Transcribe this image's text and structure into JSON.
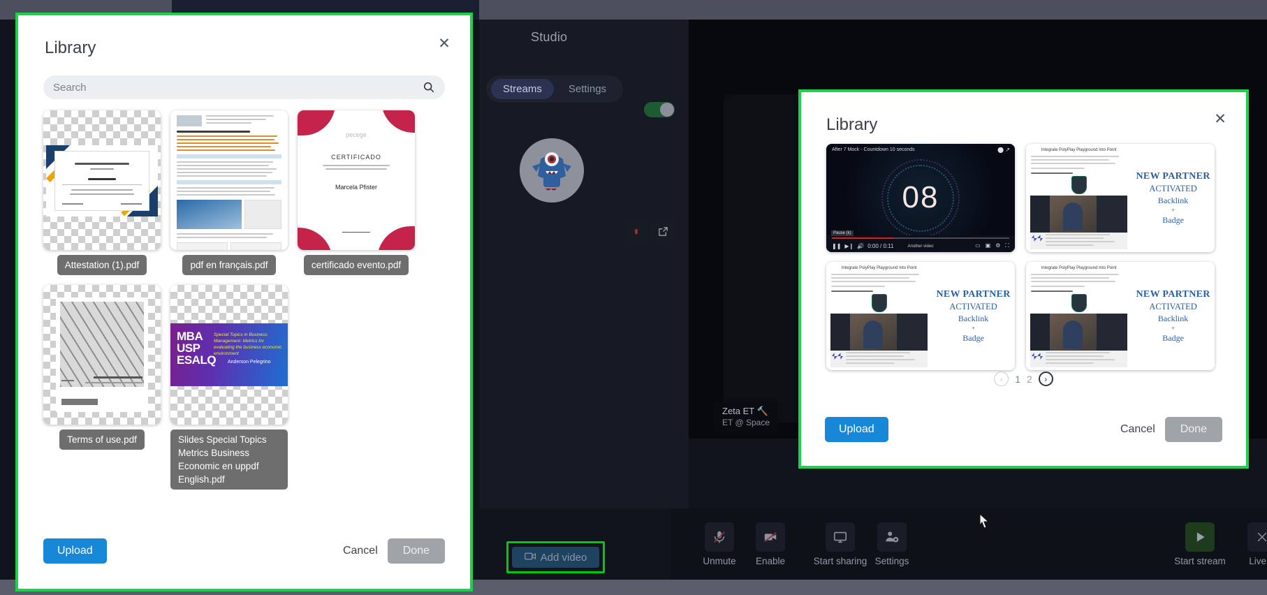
{
  "background_app": {
    "panel_title": "Studio",
    "tabs": [
      {
        "label": "Streams",
        "active": true
      },
      {
        "label": "Settings",
        "active": false
      }
    ],
    "participant": {
      "name": "Zeta ET 🔨",
      "subtitle": "ET @ Space"
    },
    "toolbar": [
      {
        "label": "Unmute",
        "icon": "microphone-muted-icon"
      },
      {
        "label": "Enable",
        "icon": "camera-disabled-icon"
      },
      {
        "label": "Start sharing",
        "icon": "monitor-icon"
      },
      {
        "label": "Settings",
        "icon": "person-gear-icon"
      }
    ],
    "right_toolbar": [
      {
        "label": "Start stream",
        "icon": "play-icon"
      },
      {
        "label": "Live S",
        "icon": "broadcast-icon"
      }
    ],
    "add_video_button": {
      "label": "Add video",
      "icon": "video-camera-icon",
      "highlighted": true,
      "highlight_color": "#00c90e"
    }
  },
  "left_modal": {
    "title": "Library",
    "close_icon": "close-icon",
    "highlight_color": "#1ed14b",
    "search": {
      "placeholder": "Search",
      "value": "",
      "icon": "search-icon"
    },
    "documents": [
      {
        "name": "Attestation (1).pdf",
        "art": "certificate"
      },
      {
        "name": "pdf en français.pdf",
        "art": "french-doc"
      },
      {
        "name": "certificado evento.pdf",
        "art": "certificado"
      },
      {
        "name": "Terms of use.pdf",
        "art": "building"
      },
      {
        "name": "Slides Special Topics Metrics Business Economic en uppdf English.pdf",
        "art": "mba"
      }
    ],
    "footer": {
      "upload_label": "Upload",
      "cancel_label": "Cancel",
      "done_label": "Done",
      "done_disabled": true
    }
  },
  "right_modal": {
    "title": "Library",
    "close_icon": "close-icon",
    "highlight_color": "#1ed14b",
    "videos": [
      {
        "art": "player",
        "player_title": "After 7 Mock - Countdown 10 seconds",
        "countdown": "08",
        "tooltip": "Pause (k)",
        "time": "0:00 / 0:11",
        "center_label": "Another video"
      },
      {
        "art": "slide",
        "heading": "NEW PARTNER",
        "line2": "ACTIVATED",
        "line3": "Backlink",
        "line4": "+",
        "line5": "Badge"
      },
      {
        "art": "slide",
        "heading": "NEW PARTNER",
        "line2": "ACTIVATED",
        "line3": "Backlink",
        "line4": "+",
        "line5": "Badge"
      },
      {
        "art": "slide",
        "heading": "NEW PARTNER",
        "line2": "ACTIVATED",
        "line3": "Backlink",
        "line4": "+",
        "line5": "Badge"
      }
    ],
    "pagination": {
      "prev_icon": "chevron-left-icon",
      "next_icon": "chevron-right-icon",
      "pages": [
        "1",
        "2"
      ],
      "current": "1"
    },
    "footer": {
      "upload_label": "Upload",
      "cancel_label": "Cancel",
      "done_label": "Done",
      "done_disabled": true
    }
  }
}
